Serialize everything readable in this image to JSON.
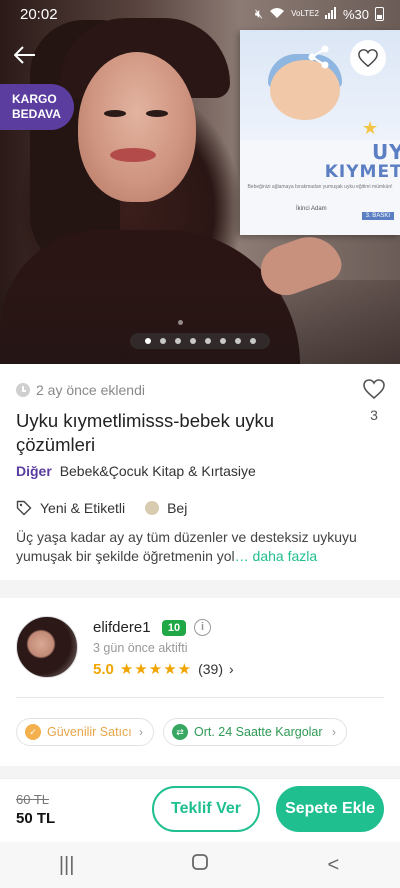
{
  "statusbar": {
    "time": "20:02",
    "network": "VoLTE2",
    "battery": "%30"
  },
  "hero": {
    "badge_line1": "KARGO",
    "badge_line2": "BEDAVA",
    "book_title_line1": "UYKU",
    "book_title_line2": "KIYMETLİMİSSS",
    "book_subtitle": "Bebeğinizi ağlamaya bırakmadan yumuşak uyku eğitimi mümkün!",
    "book_publisher": "İkinci Adam",
    "book_edition": "3. BASKI",
    "carousel_count": 8,
    "carousel_active": 1
  },
  "product": {
    "added_text": "2 ay önce eklendi",
    "like_count": "3",
    "title": "Uyku kıymetlimisss-bebek uyku çözümleri",
    "category_brand": "Diğer",
    "category_path": "Bebek&Çocuk Kitap & Kırtasiye",
    "condition": "Yeni & Etiketli",
    "color": "Bej",
    "color_hex": "#d8ccb0",
    "description": "Üç yaşa kadar ay ay tüm düzenler ve desteksiz uykuyu yumuşak bir şekilde öğretmenin yol",
    "more_label": "… daha fazla"
  },
  "seller": {
    "username": "elifdere1",
    "level": "10",
    "active_text": "3 gün önce aktifti",
    "rating": "5.0",
    "stars": "★★★★★",
    "review_count": "(39)"
  },
  "chips": {
    "trusted": "Güvenilir Satıcı",
    "cargo": "Ort. 24 Saatte Kargolar"
  },
  "purchase": {
    "old_price": "60 TL",
    "price": "50 TL",
    "offer_label": "Teklif Ver",
    "cart_label": "Sepete Ekle"
  },
  "nav": {
    "recent": "|||",
    "home": "○",
    "back": "<"
  },
  "colors": {
    "accent": "#1fbf8f",
    "brand_purple": "#5b3da0",
    "star": "#f0a500"
  }
}
